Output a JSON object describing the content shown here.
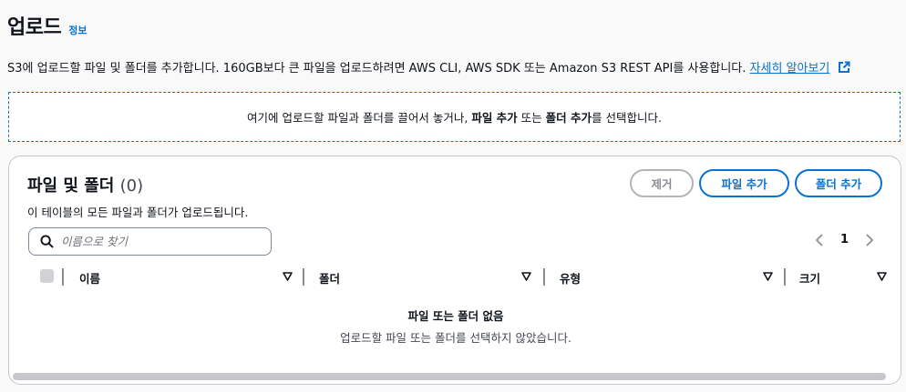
{
  "header": {
    "title": "업로드",
    "info_link": "정보"
  },
  "description": {
    "text": "S3에 업로드할 파일 및 폴더를 추가합니다. 160GB보다 큰 파일을 업로드하려면 AWS CLI, AWS SDK 또는 Amazon S3 REST API를 사용합니다.",
    "learn_more": "자세히 알아보기"
  },
  "dropzone": {
    "prefix": "여기에 업로드할 파일과 폴더를 끌어서 놓거나,",
    "add_files": "파일 추가",
    "middle": "또는",
    "add_folder": "폴더 추가",
    "suffix": "를 선택합니다."
  },
  "panel": {
    "title": "파일 및 폴더",
    "count": "(0)",
    "subtitle": "이 테이블의 모든 파일과 폴더가 업로드됩니다.",
    "buttons": {
      "remove": "제거",
      "add_files": "파일 추가",
      "add_folder": "폴더 추가"
    },
    "search_placeholder": "이름으로 찾기",
    "page": "1",
    "columns": [
      "이름",
      "폴더",
      "유형",
      "크기"
    ],
    "empty_title": "파일 또는 폴더 없음",
    "empty_subtitle": "업로드할 파일 또는 폴더를 선택하지 않았습니다."
  },
  "colors": {
    "accent": "#0972d3",
    "text": "#0f141a",
    "disabled": "#8c8c94"
  },
  "icons": [
    "external-link-icon",
    "search-icon",
    "chevron-left-icon",
    "chevron-right-icon",
    "sort-caret-icon"
  ]
}
